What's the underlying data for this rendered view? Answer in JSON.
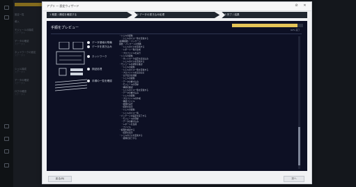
{
  "dialog": {
    "title": "アプリ — 設定ウィザード",
    "steps": [
      "1 概要 / 構成を確認する",
      "2 データの書き込み処理",
      "3 完了 / 結果"
    ],
    "content_title": "手順をプレビュー",
    "progress": 0.92,
    "progress_label": "92% 完了",
    "options": [
      "データ領域の準備",
      "データを書き込み",
      "ネットワーク",
      "検証処理",
      "手順の一覧を確認"
    ],
    "log": [
      "・シェルの起動",
      "　・シェルのパス一覧を定義する",
      "[処理開始] ・パッケージ",
      "開始 ・パッケージの準備",
      "　・シェルのパスを定義する",
      "　・レポート一覧の生成",
      "　・プロファイルを実行",
      "・シェルの起動",
      "　・ネットワーク設定を読み込み",
      "　・シェルのパスを定義する",
      "・モジュールの状態を確認",
      "　・シェルの起動",
      "　・シェルのパス一覧を定義する",
      "　・プロファイルを読み込む",
      "　・ログ出力を開始",
      "　・シェルの起動",
      "　・データの書き込み",
      "　・モジュールの登録",
      "　・構成を確認",
      "　・シェルのパス一覧を定義する",
      "　・データの書き込み",
      "　・シェルの起動",
      "　・プロファイルの作成",
      "　・構成ファイル",
      "　・処理を実行",
      "　・結果を表示",
      "　・シェルの起動",
      "　・シェルのパス一覧",
      "・パッケージの設定を完了する",
      "　・モジュールの登録",
      "　・データの書き込み",
      "　・レポートを生成",
      "　・ファイル",
      "・処理を確認する",
      "　・結果を表示",
      "・シェルのパスを定義する",
      "　・処理を完了する"
    ],
    "back_label": "戻る(B)",
    "next_label": "次へ"
  },
  "left_panel": {
    "items": [
      {
        "label": "設定一覧",
        "sub": ""
      },
      {
        "label": "導入",
        "sub": ""
      },
      {
        "label": "モジュールの構成",
        "sub": "ステータス"
      },
      {
        "label": "データの確認",
        "sub": "ステータス"
      },
      {
        "label": "ネットワークの設定",
        "sub": "ステータス"
      },
      {
        "label": "シェル構成",
        "sub": "ステータス"
      },
      {
        "label": "データの確認",
        "sub": "ステータス"
      },
      {
        "label": "ログの確認",
        "sub": "ステータス"
      }
    ]
  }
}
